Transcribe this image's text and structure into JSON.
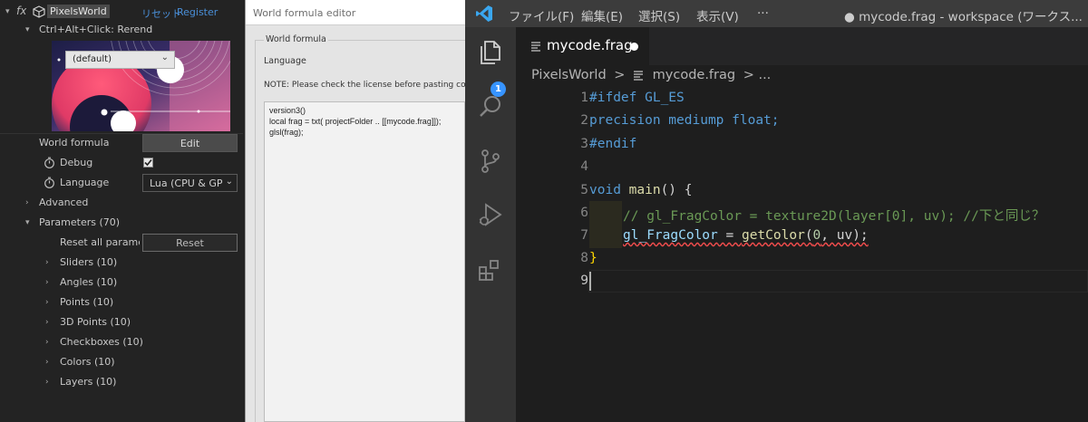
{
  "ae": {
    "header": {
      "fx_label": "fx",
      "plugin_name": "PixelsWorld",
      "reset_link": "リセット",
      "register_link": "Register"
    },
    "hint": "Ctrl+Alt+Click: Rerend",
    "world_formula": {
      "label": "World formula",
      "button": "Edit"
    },
    "debug": {
      "label": "Debug",
      "checked": true
    },
    "language": {
      "label": "Language",
      "value": "Lua (CPU & GPU"
    },
    "advanced_label": "Advanced",
    "parameters_label": "Parameters (70)",
    "reset_all": {
      "label": "Reset all paramet",
      "button": "Reset"
    },
    "groups": [
      "Sliders (10)",
      "Angles (10)",
      "Points (10)",
      "3D Points (10)",
      "Checkboxes (10)",
      "Colors (10)",
      "Layers (10)"
    ]
  },
  "editor": {
    "window_title": "World formula editor",
    "group_label": "World formula",
    "language_label": "Language",
    "language_value": "(default)",
    "note": "NOTE: Please check the license before pasting code",
    "code_lines": [
      "version3()",
      "local frag = txt( projectFolder .. [[mycode.frag]]);",
      "glsl(frag);"
    ]
  },
  "vscode": {
    "menus": [
      "ファイル(F)",
      "編集(E)",
      "選択(S)",
      "表示(V)",
      "···"
    ],
    "window_title": "● mycode.frag - workspace (ワークス...",
    "explorer_badge": "1",
    "tab_label": "mycode.frag",
    "breadcrumb": {
      "folder": "PixelsWorld",
      "sep": ">",
      "file": "mycode.frag",
      "more": "> ..."
    },
    "line_numbers": [
      "1",
      "2",
      "3",
      "4",
      "5",
      "6",
      "7",
      "8",
      "9"
    ],
    "code": {
      "l1": "#ifdef GL_ES",
      "l2": "precision mediump float;",
      "l3": "#endif",
      "l5_kw": "void",
      "l5_fn": "main",
      "l5_rest": "() {",
      "l6": "// gl_FragColor = texture2D(layer[0], uv); //下と同じ？",
      "l7_var": "gl_FragColor",
      "l7_eq": " = ",
      "l7_fn": "getColor",
      "l7_open": "(",
      "l7_num": "0",
      "l7_rest": ", uv);",
      "l8": "}"
    }
  }
}
